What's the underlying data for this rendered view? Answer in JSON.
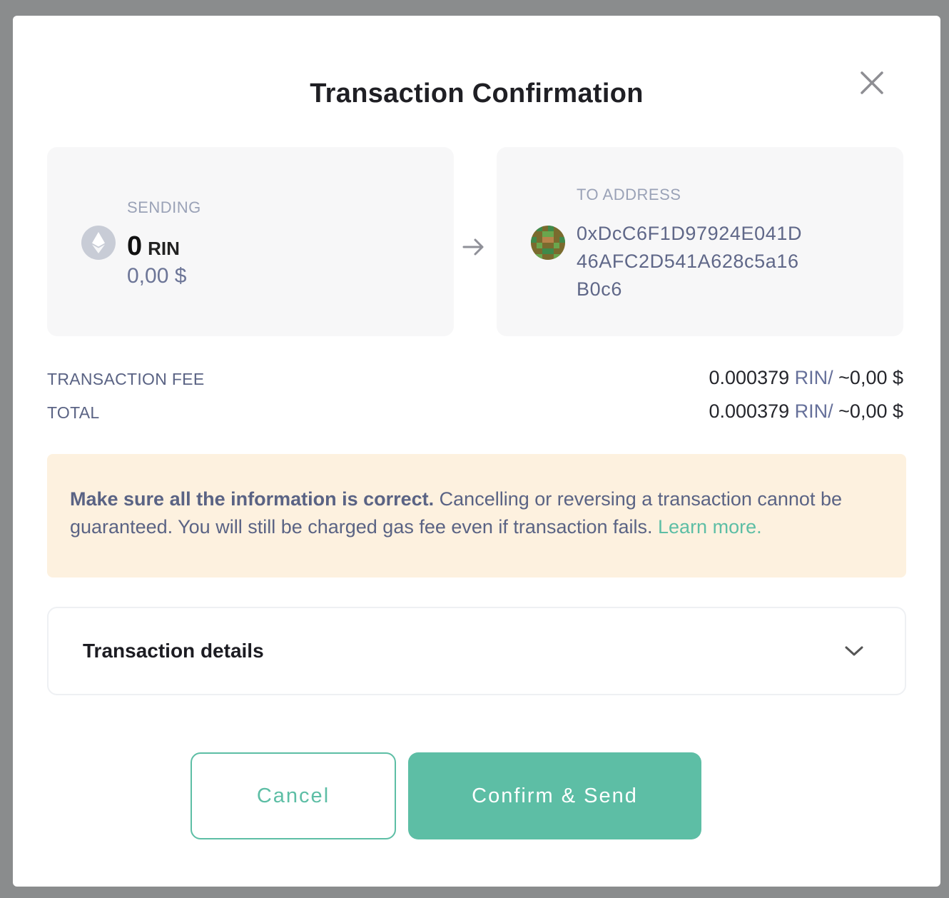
{
  "dialog": {
    "title": "Transaction Confirmation",
    "close_icon": "close-icon"
  },
  "sending": {
    "label": "SENDING",
    "amount": "0",
    "unit": "RIN",
    "fiat": "0,00 $",
    "icon": "ethereum-icon"
  },
  "recipient": {
    "label": "TO ADDRESS",
    "address": "0xDcC6F1D97924E041D46AFC2D541A628c5a16B0c6",
    "avatar": "identicon-avatar"
  },
  "fee": {
    "label": "TRANSACTION FEE",
    "amount": "0.000379",
    "unit": "RIN/",
    "fiat": "~0,00 $"
  },
  "total": {
    "label": "TOTAL",
    "amount": "0.000379",
    "unit": "RIN/",
    "fiat": "~0,00 $"
  },
  "warning": {
    "bold": "Make sure all the information is correct.",
    "text": " Cancelling or reversing a transaction cannot be guaranteed. You will still be charged gas fee even if transaction fails. ",
    "link": "Learn more."
  },
  "details": {
    "label": "Transaction details",
    "icon": "chevron-down-icon"
  },
  "actions": {
    "cancel": "Cancel",
    "confirm": "Confirm & Send"
  },
  "colors": {
    "accent": "#5dbea5",
    "warning_bg": "#fdf1df",
    "card_bg": "#f7f7f8"
  }
}
